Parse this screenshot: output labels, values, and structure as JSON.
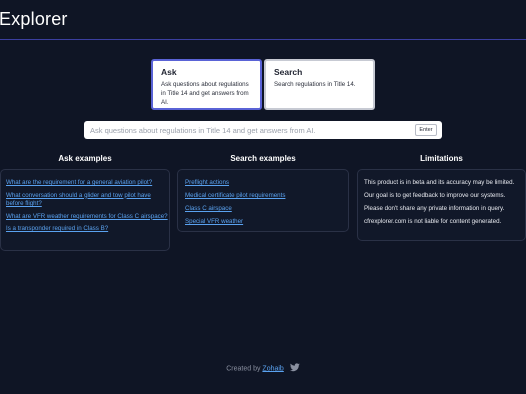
{
  "header": {
    "title": "Explorer"
  },
  "modes": {
    "ask": {
      "title": "Ask",
      "description": "Ask questions about regulations in Title 14 and get answers from AI."
    },
    "search": {
      "title": "Search",
      "description": "Search regulations in Title 14."
    }
  },
  "search": {
    "placeholder": "Ask questions about regulations in Title 14 and get answers from AI.",
    "enter_label": "Enter"
  },
  "ask_examples": {
    "heading": "Ask examples",
    "items": [
      "What are the requirement for a general aviation pilot?",
      "What conversation should a glider and tow pilot have before flight?",
      "What are VFR weather requirements for Class C airspace?",
      "Is a transponder required in Class B?"
    ]
  },
  "search_examples": {
    "heading": "Search examples",
    "items": [
      "Preflight actions",
      "Medical certificate pilot requirements",
      "Class C airspace",
      "Special VFR weather"
    ]
  },
  "limitations": {
    "heading": "Limitations",
    "items": [
      "This product is in beta and its accuracy may be limited.",
      "Our goal is to get feedback to improve our systems.",
      "Please don't share any private information in query.",
      "cfrexplorer.com is not liable for content generated."
    ]
  },
  "footer": {
    "prefix": "Created by",
    "author": "Zohaib",
    "icon": "twitter-icon"
  },
  "colors": {
    "background": "#0f1525",
    "accent": "#5a63d6",
    "link": "#5aa2f0"
  }
}
